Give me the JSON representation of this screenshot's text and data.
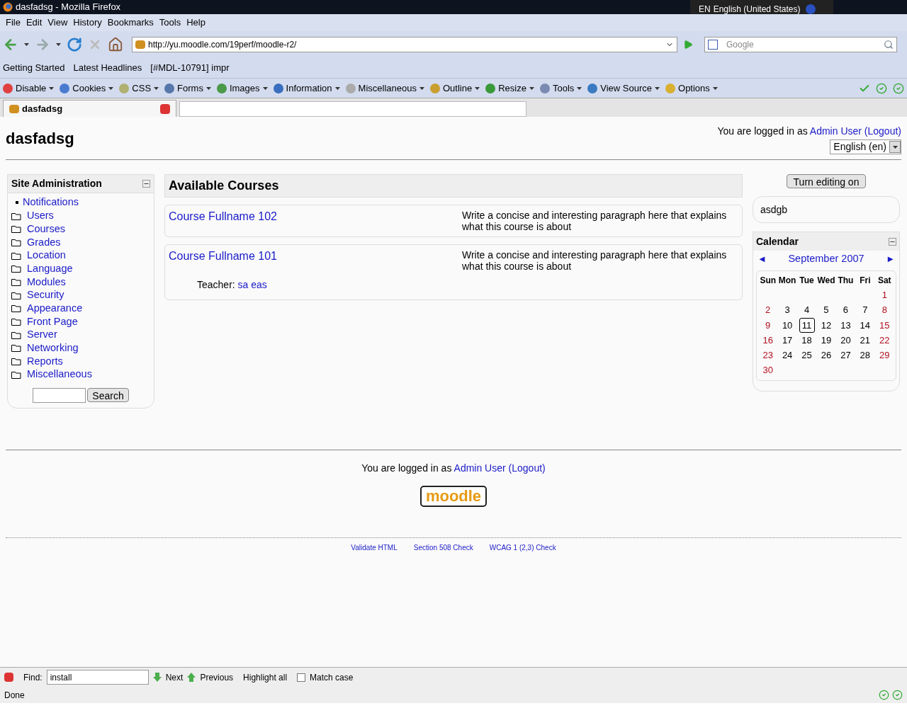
{
  "window": {
    "title": "dasfadsg - Mozilla Firefox",
    "language_code": "EN",
    "language_name": "English (United States)"
  },
  "menu": [
    "File",
    "Edit",
    "View",
    "History",
    "Bookmarks",
    "Tools",
    "Help"
  ],
  "navigation": {
    "url": "http://yu.moodle.com/19perf/moodle-r2/",
    "search_placeholder": "Google"
  },
  "bookmarks": [
    "Getting Started",
    "Latest Headlines",
    "[#MDL-10791] impr"
  ],
  "dev_toolbar": [
    "Disable",
    "Cookies",
    "CSS",
    "Forms",
    "Images",
    "Information",
    "Miscellaneous",
    "Outline",
    "Resize",
    "Tools",
    "View Source",
    "Options"
  ],
  "tabs": [
    {
      "label": "dasfadsg",
      "selected": true
    }
  ],
  "page": {
    "site_title": "dasfadsg",
    "login_prefix": "You are logged in as",
    "user": "Admin User",
    "logout": "(Logout)",
    "language": "English (en)"
  },
  "admin_block": {
    "title": "Site Administration",
    "items": [
      {
        "label": "Notifications",
        "kind": "leaf"
      },
      {
        "label": "Users",
        "kind": "folder"
      },
      {
        "label": "Courses",
        "kind": "folder"
      },
      {
        "label": "Grades",
        "kind": "folder"
      },
      {
        "label": "Location",
        "kind": "folder"
      },
      {
        "label": "Language",
        "kind": "folder"
      },
      {
        "label": "Modules",
        "kind": "folder"
      },
      {
        "label": "Security",
        "kind": "folder"
      },
      {
        "label": "Appearance",
        "kind": "folder"
      },
      {
        "label": "Front Page",
        "kind": "folder"
      },
      {
        "label": "Server",
        "kind": "folder"
      },
      {
        "label": "Networking",
        "kind": "folder"
      },
      {
        "label": "Reports",
        "kind": "folder"
      },
      {
        "label": "Miscellaneous",
        "kind": "folder"
      }
    ],
    "search_button": "Search"
  },
  "courses": {
    "heading": "Available Courses",
    "items": [
      {
        "name": "Course Fullname 102",
        "summary": "Write a concise and interesting paragraph here that explains what this course is about"
      },
      {
        "name": "Course Fullname 101",
        "summary": "Write a concise and interesting paragraph here that explains what this course is about",
        "teacher_label": "Teacher:",
        "teacher": "sa eas"
      }
    ]
  },
  "edit_button": "Turn editing on",
  "html_block": "asdgb",
  "calendar": {
    "title": "Calendar",
    "prev": "◄",
    "month": "September 2007",
    "next": "►",
    "weekdays": [
      "Sun",
      "Mon",
      "Tue",
      "Wed",
      "Thu",
      "Fri",
      "Sat"
    ],
    "weeks": [
      {
        "right_aligned": true,
        "days": [
          {
            "day": "1",
            "weekend": true,
            "today": false
          }
        ]
      },
      {
        "right_aligned": false,
        "days": [
          {
            "day": "2",
            "weekend": true,
            "today": false
          },
          {
            "day": "3",
            "weekend": false,
            "today": false
          },
          {
            "day": "4",
            "weekend": false,
            "today": false
          },
          {
            "day": "5",
            "weekend": false,
            "today": false
          },
          {
            "day": "6",
            "weekend": false,
            "today": false
          },
          {
            "day": "7",
            "weekend": false,
            "today": false
          },
          {
            "day": "8",
            "weekend": true,
            "today": false
          }
        ]
      },
      {
        "right_aligned": false,
        "days": [
          {
            "day": "9",
            "weekend": true,
            "today": false
          },
          {
            "day": "10",
            "weekend": false,
            "today": false
          },
          {
            "day": "11",
            "weekend": false,
            "today": true
          },
          {
            "day": "12",
            "weekend": false,
            "today": false
          },
          {
            "day": "13",
            "weekend": false,
            "today": false
          },
          {
            "day": "14",
            "weekend": false,
            "today": false
          },
          {
            "day": "15",
            "weekend": true,
            "today": false
          }
        ]
      },
      {
        "right_aligned": false,
        "days": [
          {
            "day": "16",
            "weekend": true,
            "today": false
          },
          {
            "day": "17",
            "weekend": false,
            "today": false
          },
          {
            "day": "18",
            "weekend": false,
            "today": false
          },
          {
            "day": "19",
            "weekend": false,
            "today": false
          },
          {
            "day": "20",
            "weekend": false,
            "today": false
          },
          {
            "day": "21",
            "weekend": false,
            "today": false
          },
          {
            "day": "22",
            "weekend": true,
            "today": false
          }
        ]
      },
      {
        "right_aligned": false,
        "days": [
          {
            "day": "23",
            "weekend": true,
            "today": false
          },
          {
            "day": "24",
            "weekend": false,
            "today": false
          },
          {
            "day": "25",
            "weekend": false,
            "today": false
          },
          {
            "day": "26",
            "weekend": false,
            "today": false
          },
          {
            "day": "27",
            "weekend": false,
            "today": false
          },
          {
            "day": "28",
            "weekend": false,
            "today": false
          },
          {
            "day": "29",
            "weekend": true,
            "today": false
          }
        ]
      },
      {
        "right_aligned": false,
        "days": [
          {
            "day": "30",
            "weekend": true,
            "today": false
          }
        ]
      }
    ]
  },
  "footer": {
    "login_prefix": "You are logged in as",
    "user": "Admin User",
    "logout": "(Logout)",
    "logo": "moodle",
    "links": [
      "Validate HTML",
      "Section 508 Check",
      "WCAG 1 (2,3) Check"
    ]
  },
  "find_bar": {
    "label": "Find:",
    "value": "install",
    "next": "Next",
    "previous": "Previous",
    "highlight": "Highlight all",
    "match_case": {
      "label": "Match case",
      "checked": false
    }
  },
  "status_bar": "Done"
}
